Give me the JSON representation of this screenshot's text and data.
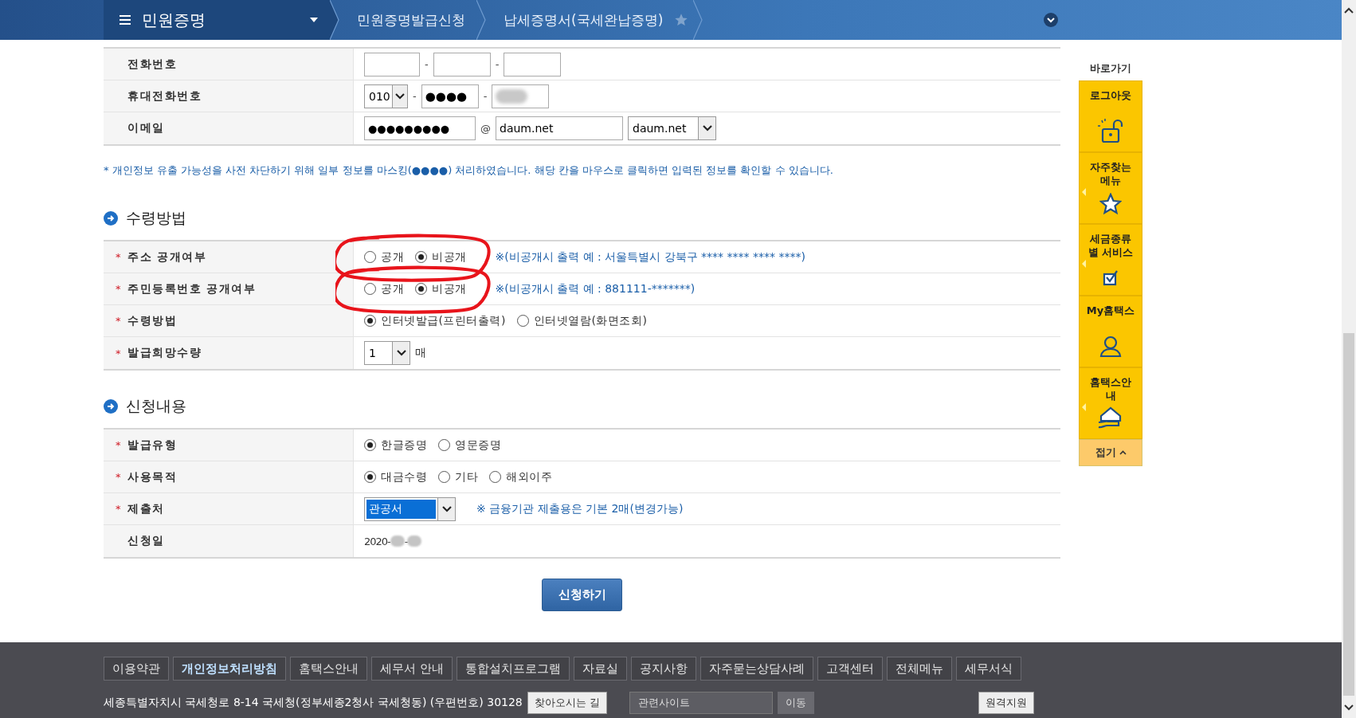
{
  "nav": {
    "title": "민원증명",
    "breadcrumbs": [
      {
        "label": "민원증명발급신청"
      },
      {
        "label": "납세증명서(국세완납증명)"
      }
    ],
    "favorite": false
  },
  "contact_rows": [
    {
      "kind": "phone",
      "label": "전화번호",
      "separators": [
        "-",
        "-"
      ]
    },
    {
      "kind": "mobile",
      "label": "휴대전화번호",
      "prefix": "010",
      "middle": "●●●●",
      "separators": [
        "-",
        "-"
      ]
    },
    {
      "kind": "email",
      "label": "이메일",
      "user": "●●●●●●●●●",
      "at": "@",
      "domain": "daum.net",
      "domain_select": "daum.net"
    }
  ],
  "notice": "* 개인정보 유출 가능성을 사전 차단하기 위해 일부 정보를 마스킹(●●●●) 처리하였습니다. 해당 칸을 마우스로 클릭하면 입력된 정보를 확인할 수 있습니다.",
  "required_mark": "*",
  "sections": [
    {
      "title": "수령방법",
      "rows": [
        {
          "kind": "radio",
          "label": "주소 공개여부",
          "required": true,
          "circled": true,
          "options": [
            {
              "label": "공개",
              "selected": false
            },
            {
              "label": "비공개",
              "selected": true
            }
          ],
          "note": "※(비공개시 출력 예 : 서울특별시 강북구 **** **** **** ****)"
        },
        {
          "kind": "radio",
          "label": "주민등록번호 공개여부",
          "required": true,
          "circled": true,
          "options": [
            {
              "label": "공개",
              "selected": false
            },
            {
              "label": "비공개",
              "selected": true
            }
          ],
          "note": "※(비공개시 출력 예 : 881111-*******)"
        },
        {
          "kind": "radio",
          "label": "수령방법",
          "required": true,
          "options": [
            {
              "label": "인터넷발급(프린터출력)",
              "selected": true
            },
            {
              "label": "인터넷열람(화면조회)",
              "selected": false
            }
          ]
        },
        {
          "kind": "select",
          "label": "발급희망수량",
          "required": true,
          "value": "1",
          "unit": "매"
        }
      ]
    },
    {
      "title": "신청내용",
      "rows": [
        {
          "kind": "radio",
          "label": "발급유형",
          "required": true,
          "options": [
            {
              "label": "한글증명",
              "selected": true
            },
            {
              "label": "영문증명",
              "selected": false
            }
          ]
        },
        {
          "kind": "radio",
          "label": "사용목적",
          "required": true,
          "options": [
            {
              "label": "대금수령",
              "selected": true
            },
            {
              "label": "기타",
              "selected": false
            },
            {
              "label": "해외이주",
              "selected": false
            }
          ]
        },
        {
          "kind": "select",
          "label": "제출처",
          "required": true,
          "value": "관공서",
          "focused": true,
          "note": "※ 금융기관 제출용은 기본 2매(변경가능)"
        },
        {
          "kind": "date",
          "label": "신청일",
          "parts": [
            "2020-",
            "-"
          ]
        }
      ]
    }
  ],
  "submit": "신청하기",
  "quick_menu": {
    "title": "바로가기",
    "items": [
      {
        "label": "로그아웃",
        "kind": "logout",
        "arrow": false
      },
      {
        "label": "자주찾는 메뉴",
        "kind": "favorites",
        "arrow": true
      },
      {
        "label": "세금종류별 서비스",
        "kind": "tax_services",
        "arrow": true
      },
      {
        "label": "My홈택스",
        "kind": "my_hometax",
        "arrow": false
      },
      {
        "label": "홈택스안내",
        "kind": "guide",
        "arrow": true
      }
    ],
    "collapse": "접기"
  },
  "footer": {
    "links": [
      {
        "label": "이용약관",
        "emphasis": false
      },
      {
        "label": "개인정보처리방침",
        "emphasis": true
      },
      {
        "label": "홈택스안내",
        "emphasis": false
      },
      {
        "label": "세무서 안내",
        "emphasis": false
      },
      {
        "label": "통합설치프로그램",
        "emphasis": false
      },
      {
        "label": "자료실",
        "emphasis": false
      },
      {
        "label": "공지사항",
        "emphasis": false
      },
      {
        "label": "자주묻는상담사례",
        "emphasis": false
      },
      {
        "label": "고객센터",
        "emphasis": false
      },
      {
        "label": "전체메뉴",
        "emphasis": false
      },
      {
        "label": "세무서식",
        "emphasis": false
      }
    ],
    "address": "세종특별자치시 국세청로 8-14 국세청(정부세종2청사 국세청동) (우편번호) 30128",
    "directions": "찾아오시는 길",
    "related_select": "관련사이트",
    "go": "이동",
    "remote": "원격지원"
  }
}
